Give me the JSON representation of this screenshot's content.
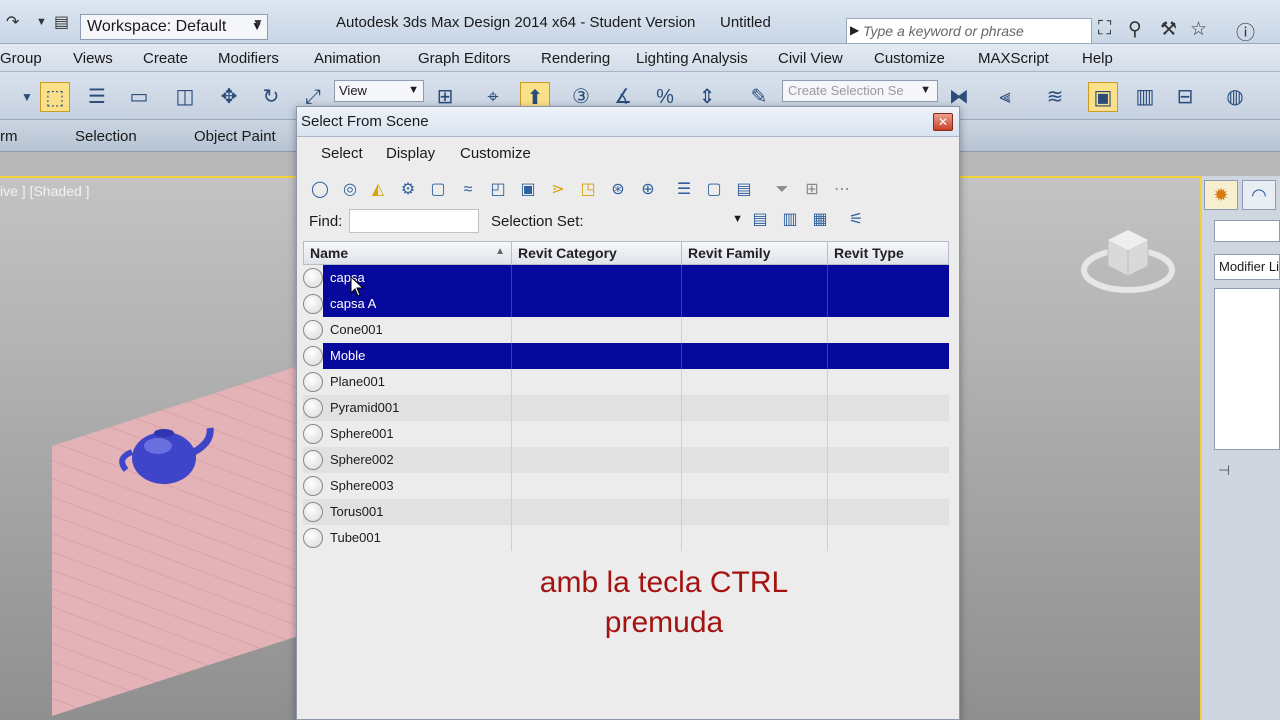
{
  "titlebar": {
    "workspace": "Workspace: Default",
    "app_title": "Autodesk 3ds Max Design 2014 x64 - Student Version",
    "doc_title": "Untitled",
    "search_placeholder": "Type a keyword or phrase"
  },
  "menu": [
    "Group",
    "Views",
    "Create",
    "Modifiers",
    "Animation",
    "Graph Editors",
    "Rendering",
    "Lighting Analysis",
    "Civil View",
    "Customize",
    "MAXScript",
    "Help"
  ],
  "toolbar": {
    "view_label": "View",
    "selection_set_placeholder": "Create Selection Se"
  },
  "ribbon": {
    "tabs": [
      "rm",
      "Selection",
      "Object Paint"
    ]
  },
  "viewport": {
    "label": "ive ] [Shaded ]"
  },
  "command_panel": {
    "modifier_list": "Modifier Li"
  },
  "dialog": {
    "title": "Select From Scene",
    "close_glyph": "✕",
    "menu": [
      "Select",
      "Display",
      "Customize"
    ],
    "find_label": "Find:",
    "find_value": "",
    "selection_set_label": "Selection Set:",
    "columns": [
      "Name",
      "Revit Category",
      "Revit Family",
      "Revit Type"
    ],
    "rows": [
      {
        "name": "capsa",
        "selected": true
      },
      {
        "name": "capsa A",
        "selected": true
      },
      {
        "name": "Cone001",
        "selected": false
      },
      {
        "name": "Moble",
        "selected": true
      },
      {
        "name": "Plane001",
        "selected": false
      },
      {
        "name": "Pyramid001",
        "selected": false
      },
      {
        "name": "Sphere001",
        "selected": false
      },
      {
        "name": "Sphere002",
        "selected": false
      },
      {
        "name": "Sphere003",
        "selected": false
      },
      {
        "name": "Torus001",
        "selected": false
      },
      {
        "name": "Tube001",
        "selected": false
      }
    ]
  },
  "caption": {
    "line1": "amb la tecla CTRL",
    "line2": "premuda"
  },
  "colors": {
    "selection": "#07089c",
    "caption": "#a41212",
    "viewport_border": "#f2d33b"
  }
}
